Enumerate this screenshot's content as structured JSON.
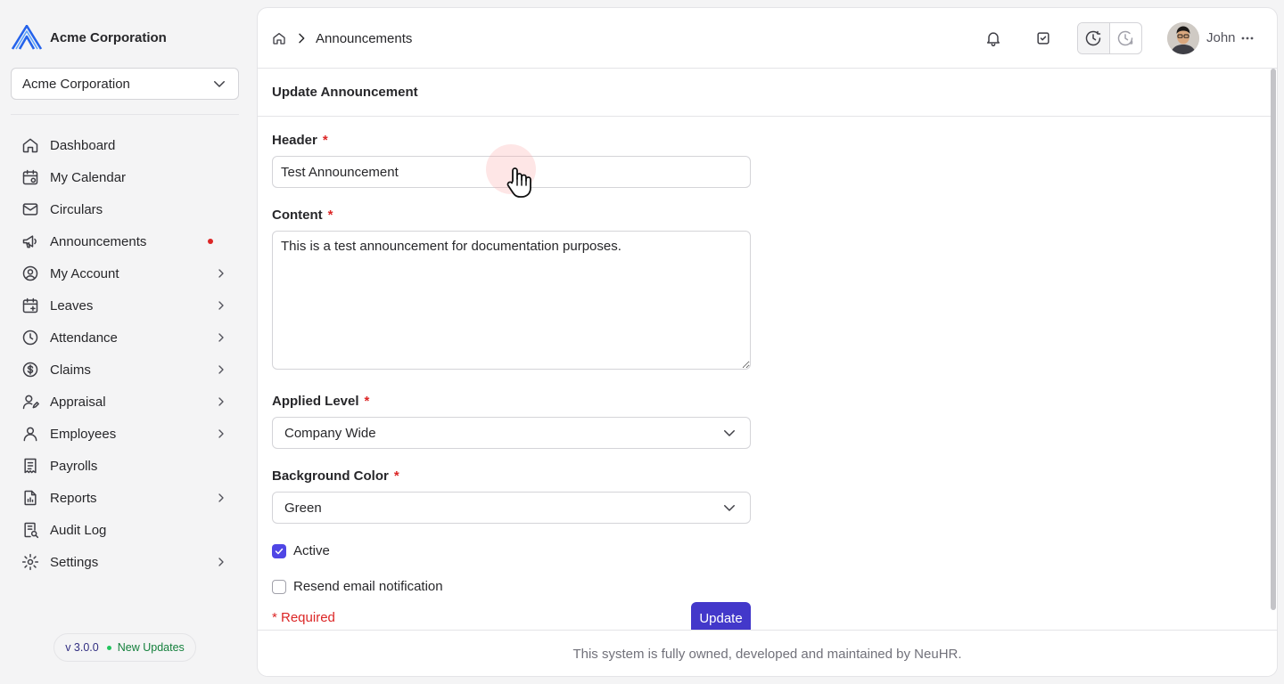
{
  "brand": {
    "name": "Acme Corporation"
  },
  "org_select": {
    "value": "Acme Corporation"
  },
  "sidebar": {
    "items": [
      {
        "label": "Dashboard",
        "icon": "home-icon"
      },
      {
        "label": "My Calendar",
        "icon": "calendar-icon"
      },
      {
        "label": "Circulars",
        "icon": "mail-icon"
      },
      {
        "label": "Announcements",
        "icon": "megaphone-icon",
        "badge": "unread-dot"
      },
      {
        "label": "My Account",
        "icon": "user-circle-icon",
        "expandable": true
      },
      {
        "label": "Leaves",
        "icon": "calendar-leave-icon",
        "expandable": true
      },
      {
        "label": "Attendance",
        "icon": "clock-icon",
        "expandable": true
      },
      {
        "label": "Claims",
        "icon": "dollar-circle-icon",
        "expandable": true
      },
      {
        "label": "Appraisal",
        "icon": "user-edit-icon",
        "expandable": true
      },
      {
        "label": "Employees",
        "icon": "user-icon",
        "expandable": true
      },
      {
        "label": "Payrolls",
        "icon": "receipt-icon"
      },
      {
        "label": "Reports",
        "icon": "report-icon",
        "expandable": true
      },
      {
        "label": "Audit Log",
        "icon": "audit-icon"
      },
      {
        "label": "Settings",
        "icon": "gear-icon",
        "expandable": true
      }
    ]
  },
  "version": {
    "number": "v 3.0.0",
    "updates": "New Updates"
  },
  "breadcrumb": {
    "current": "Announcements"
  },
  "user": {
    "name": "John"
  },
  "form": {
    "title": "Update Announcement",
    "header_label": "Header",
    "header_value": "Test Announcement",
    "content_label": "Content",
    "content_value": "This is a test announcement for documentation purposes.",
    "applied_level_label": "Applied Level",
    "applied_level_value": "Company Wide",
    "background_color_label": "Background Color",
    "background_color_value": "Green",
    "active_label": "Active",
    "active_checked": true,
    "resend_label": "Resend email notification",
    "resend_checked": false,
    "required_note": "* Required",
    "required_marker": "*",
    "update_label": "Update"
  },
  "footer": {
    "text": "This system is fully owned, developed and maintained by NeuHR."
  },
  "colors": {
    "accent": "#4338ca",
    "checkbox": "#4f46e5",
    "danger": "#dc2626",
    "success": "#22c55e"
  }
}
